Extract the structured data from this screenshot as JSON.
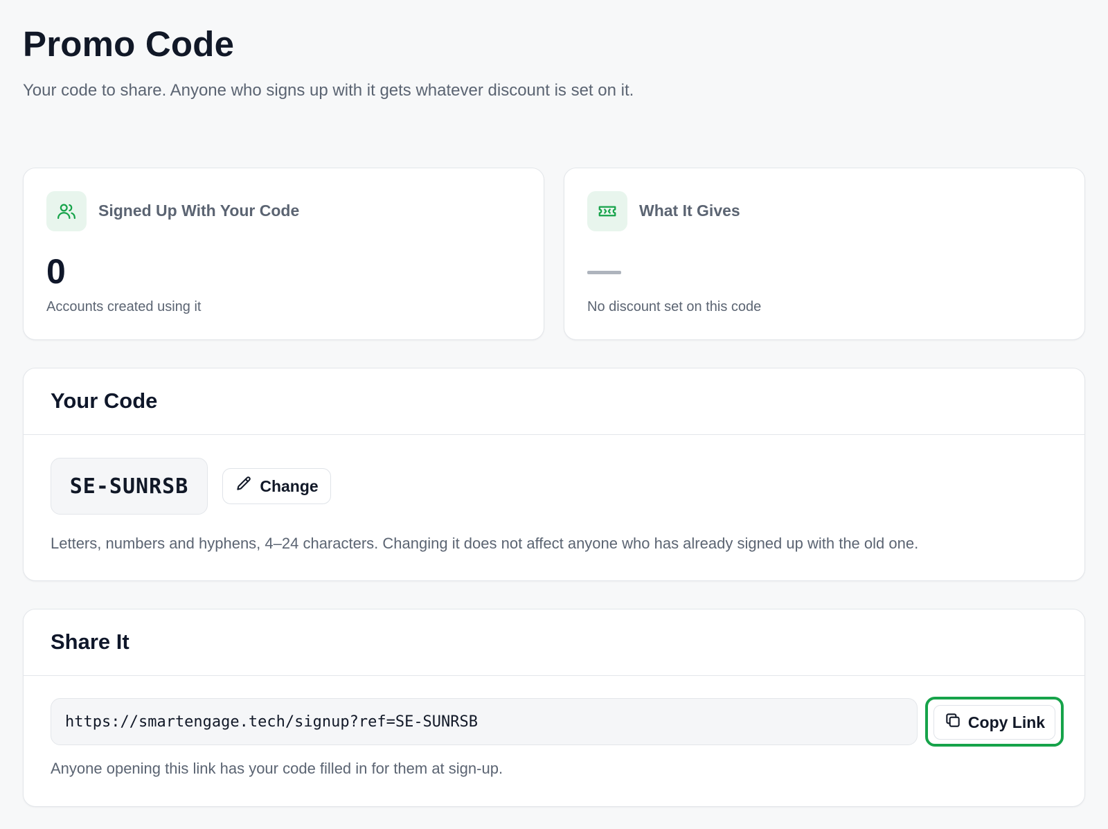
{
  "header": {
    "title": "Promo Code",
    "subtitle": "Your code to share. Anyone who signs up with it gets whatever discount is set on it."
  },
  "stats": {
    "signups": {
      "icon": "users-icon",
      "label": "Signed Up With Your Code",
      "value": "0",
      "caption": "Accounts created using it"
    },
    "discount": {
      "icon": "ticket-icon",
      "label": "What It Gives",
      "value": "—",
      "caption": "No discount set on this code"
    }
  },
  "your_code": {
    "title": "Your Code",
    "code": "SE-SUNRSB",
    "change_label": "Change",
    "help": "Letters, numbers and hyphens, 4–24 characters. Changing it does not affect anyone who has already signed up with the old one."
  },
  "share": {
    "title": "Share It",
    "link": "https://smartengage.tech/signup?ref=SE-SUNRSB",
    "copy_label": "Copy Link",
    "help": "Anyone opening this link has your code filled in for them at sign-up."
  },
  "colors": {
    "accent": "#16a34a",
    "icon_bg": "#e8f5ed",
    "page_bg": "#f7f8f9"
  }
}
